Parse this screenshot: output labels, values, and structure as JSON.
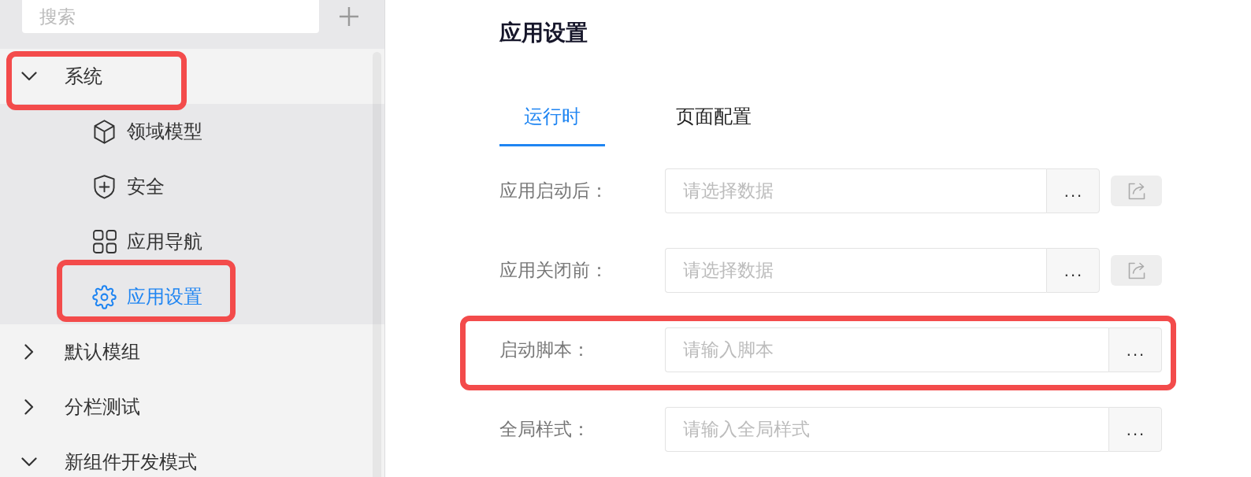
{
  "sidebar": {
    "search": {
      "placeholder": "搜索"
    },
    "tree": [
      {
        "label": "系统",
        "expanded": true,
        "highlighted": true,
        "children": [
          {
            "label": "领域模型",
            "kind": "model",
            "selected": false,
            "highlighted": false
          },
          {
            "label": "安全",
            "kind": "security",
            "selected": false,
            "highlighted": false
          },
          {
            "label": "应用导航",
            "kind": "navigation",
            "selected": false,
            "highlighted": false
          },
          {
            "label": "应用设置",
            "kind": "settings",
            "selected": true,
            "highlighted": true
          }
        ]
      },
      {
        "label": "默认模组",
        "expanded": false,
        "highlighted": false
      },
      {
        "label": "分栏测试",
        "expanded": false,
        "highlighted": false
      },
      {
        "label": "新组件开发模式",
        "expanded": true,
        "highlighted": false
      }
    ]
  },
  "main": {
    "title": "应用设置",
    "tabs": [
      {
        "label": "运行时",
        "selected": true
      },
      {
        "label": "页面配置",
        "selected": false
      }
    ],
    "fields": [
      {
        "label": "应用启动后：",
        "kind": "data",
        "placeholder": "请选择数据",
        "button": "...",
        "highlighted": false
      },
      {
        "label": "应用关闭前：",
        "kind": "data",
        "placeholder": "请选择数据",
        "button": "...",
        "highlighted": false
      },
      {
        "label": "启动脚本：",
        "kind": "script",
        "placeholder": "请输入脚本",
        "button": "...",
        "highlighted": true
      },
      {
        "label": "全局样式：",
        "kind": "script",
        "placeholder": "请输入全局样式",
        "button": "...",
        "highlighted": false
      }
    ]
  }
}
